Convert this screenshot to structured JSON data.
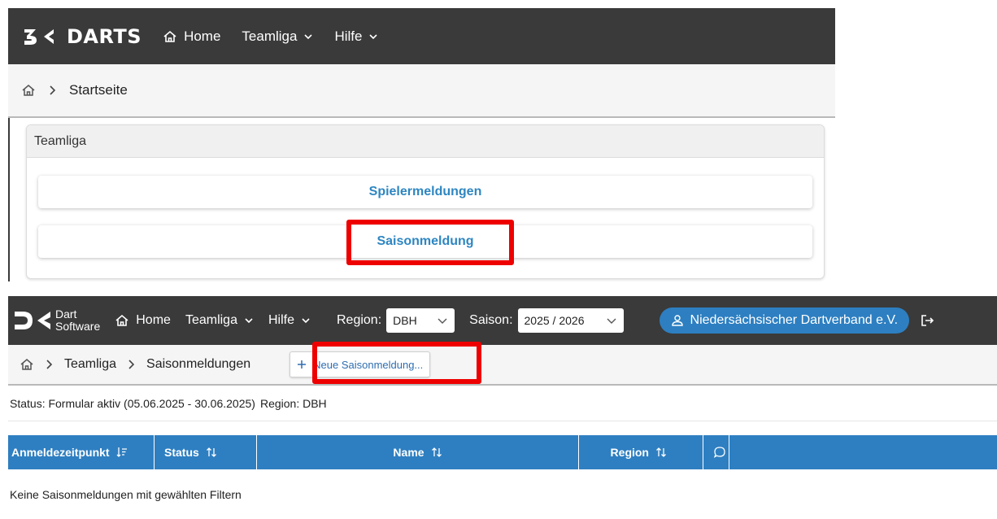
{
  "screen1": {
    "brand": "DARTS",
    "nav": {
      "home": "Home",
      "teamliga": "Teamliga",
      "hilfe": "Hilfe"
    },
    "breadcrumb": {
      "current": "Startseite"
    },
    "card": {
      "title": "Teamliga",
      "buttons": [
        "Spielermeldungen",
        "Saisonmeldung"
      ]
    }
  },
  "screen2": {
    "logo": {
      "line1": "Dart",
      "line2": "Software"
    },
    "nav": {
      "home": "Home",
      "teamliga": "Teamliga",
      "hilfe": "Hilfe"
    },
    "region": {
      "label": "Region:",
      "value": "DBH"
    },
    "saison": {
      "label": "Saison:",
      "value": "2025 / 2026"
    },
    "user": "Niedersächsischer Dartverband e.V.",
    "breadcrumb": {
      "items": [
        "Teamliga",
        "Saisonmeldungen"
      ],
      "new_button": "Neue Saisonmeldung..."
    },
    "status": {
      "text": "Status: Formular aktiv (05.06.2025 - 30.06.2025)",
      "region": "Region: DBH"
    },
    "table": {
      "columns": [
        "Anmeldezeitpunkt",
        "Status",
        "Name",
        "Region"
      ],
      "empty_message": "Keine Saisonmeldungen mit gewählten Filtern"
    }
  },
  "colors": {
    "nav_bg": "#3a3a3a",
    "accent_blue": "#2e7fc1",
    "link_blue": "#2e86c1",
    "highlight_red": "#ee0000"
  }
}
